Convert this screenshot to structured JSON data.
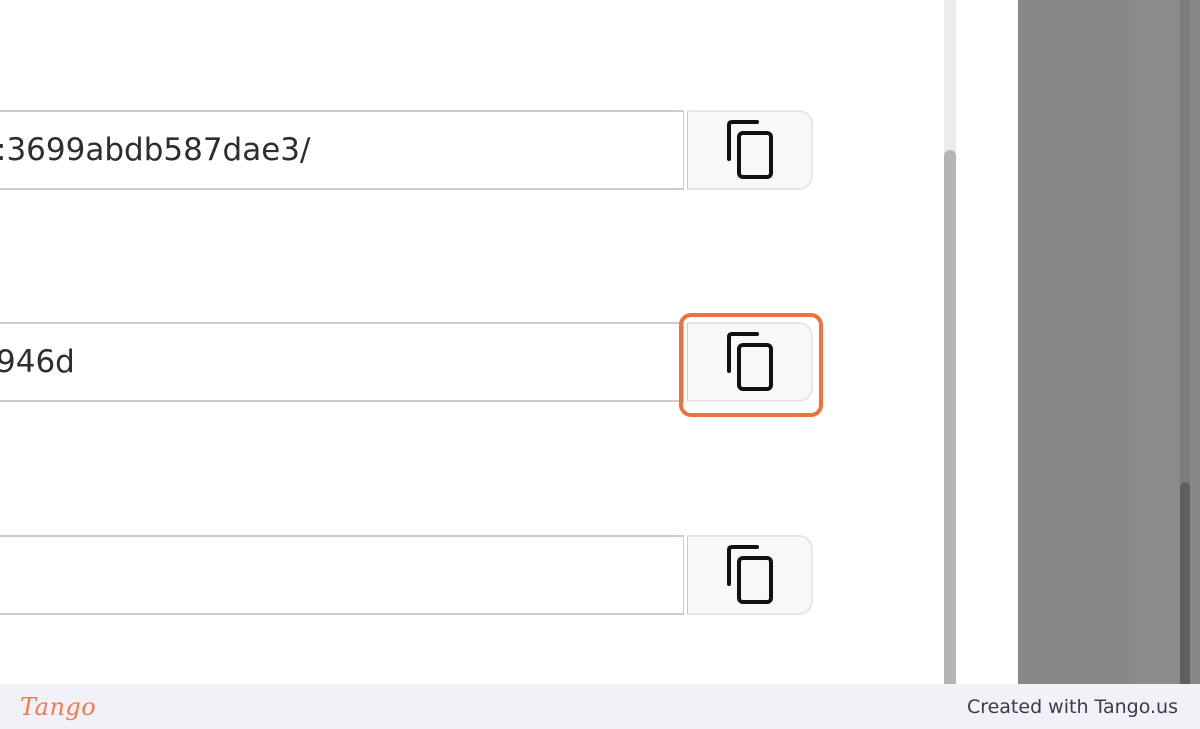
{
  "fields": [
    {
      "value": ":3699abdb587dae3/",
      "copy_icon": "copy-icon"
    },
    {
      "value": "946d",
      "copy_icon": "copy-icon"
    },
    {
      "value": "",
      "copy_icon": "copy-icon"
    }
  ],
  "highlight": {
    "color": "#f36f3c",
    "target": "copy-button-2"
  },
  "footer": {
    "brand": "Tango",
    "credit": "Created with Tango.us"
  },
  "colors": {
    "accent": "#f36f3c",
    "footer_bg": "#f2f1f7",
    "overlay": "#888888"
  }
}
